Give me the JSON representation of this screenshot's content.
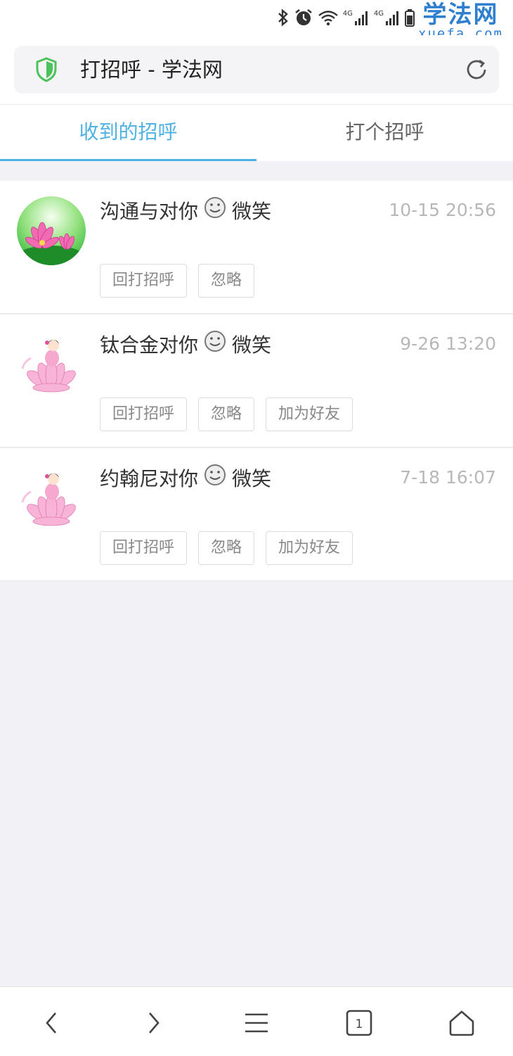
{
  "watermark": {
    "cn": "学法网",
    "en": "xuefa.com"
  },
  "status": {
    "net_label_1": "4G",
    "net_label_2": "4G"
  },
  "header": {
    "title": "打招呼 - 学法网"
  },
  "tabs": [
    {
      "label": "收到的招呼",
      "active": true
    },
    {
      "label": "打个招呼",
      "active": false
    }
  ],
  "colors": {
    "accent": "#4fb2e3",
    "shield": "#4cc25a"
  },
  "greetings": [
    {
      "name": "沟通与对你",
      "action": "微笑",
      "time": "10-15 20:56",
      "buttons": [
        "回打招呼",
        "忽略"
      ]
    },
    {
      "name": "钛合金对你",
      "action": "微笑",
      "time": "9-26 13:20",
      "buttons": [
        "回打招呼",
        "忽略",
        "加为好友"
      ]
    },
    {
      "name": "约翰尼对你",
      "action": "微笑",
      "time": "7-18 16:07",
      "buttons": [
        "回打招呼",
        "忽略",
        "加为好友"
      ]
    }
  ],
  "nav": {
    "tab_count": "1"
  }
}
